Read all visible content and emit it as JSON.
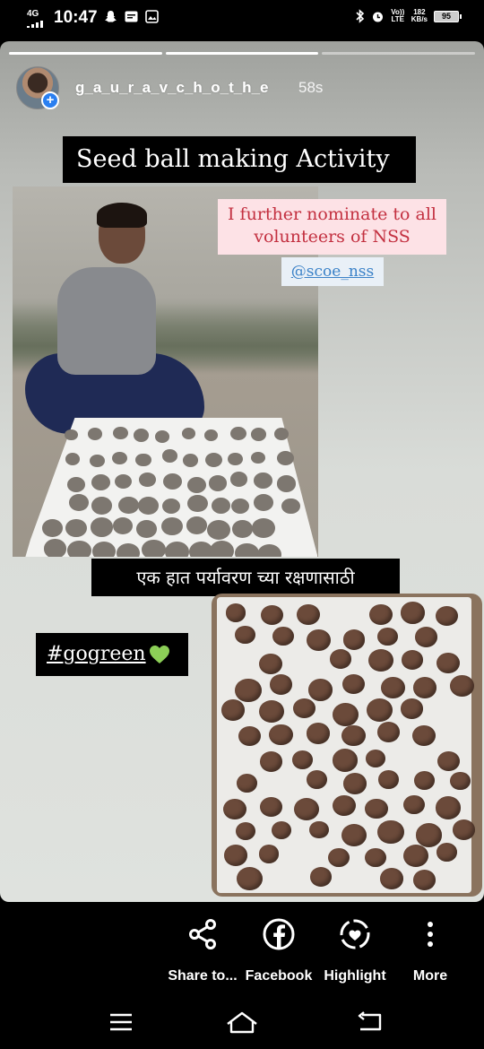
{
  "status_bar": {
    "network": "4G",
    "time": "10:47",
    "volte": "Vo)) LTE",
    "speed_value": "182",
    "speed_unit": "KB/s",
    "battery": "95"
  },
  "story": {
    "username": "g_a_u_r_a_v_c_h_o_t_h_e",
    "time_ago": "58s",
    "progress": {
      "segments": 3,
      "current": 2
    },
    "title": "Seed ball making Activity",
    "nominate_text": "I further nominate to all volunteers of NSS",
    "mention": "@scoe_nss",
    "marathi_caption": "एक हात पर्यावरण च्या रक्षणासाठी",
    "hashtag": "#gogreen",
    "heart_color": "#8ccf57"
  },
  "actions": [
    {
      "label": "Share to...",
      "icon": "share-icon"
    },
    {
      "label": "Facebook",
      "icon": "facebook-icon"
    },
    {
      "label": "Highlight",
      "icon": "highlight-icon"
    },
    {
      "label": "More",
      "icon": "more-icon"
    }
  ],
  "nav": [
    "menu-icon",
    "home-icon",
    "back-icon"
  ]
}
